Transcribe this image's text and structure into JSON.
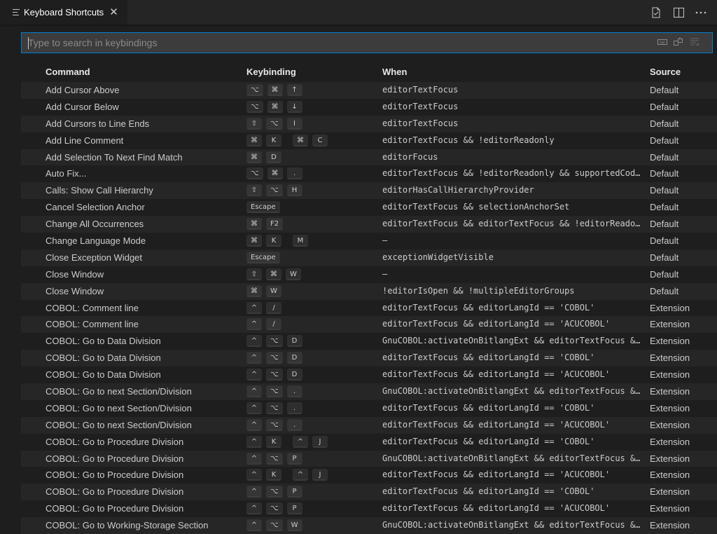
{
  "tab": {
    "title": "Keyboard Shortcuts",
    "close": "✕"
  },
  "actions": [
    "open-json-icon",
    "split-editor-icon",
    "more-actions-icon"
  ],
  "search": {
    "placeholder": "Type to search in keybindings",
    "value": ""
  },
  "columns": {
    "command": "Command",
    "keybinding": "Keybinding",
    "when": "When",
    "source": "Source"
  },
  "rows": [
    {
      "command": "Add Cursor Above",
      "keys": [
        [
          "⌥",
          "⌘",
          "↑"
        ]
      ],
      "when": "editorTextFocus",
      "source": "Default"
    },
    {
      "command": "Add Cursor Below",
      "keys": [
        [
          "⌥",
          "⌘",
          "↓"
        ]
      ],
      "when": "editorTextFocus",
      "source": "Default"
    },
    {
      "command": "Add Cursors to Line Ends",
      "keys": [
        [
          "⇧",
          "⌥",
          "I"
        ]
      ],
      "when": "editorTextFocus",
      "source": "Default"
    },
    {
      "command": "Add Line Comment",
      "keys": [
        [
          "⌘",
          "K"
        ],
        [
          "⌘",
          "C"
        ]
      ],
      "when": "editorTextFocus && !editorReadonly",
      "source": "Default"
    },
    {
      "command": "Add Selection To Next Find Match",
      "keys": [
        [
          "⌘",
          "D"
        ]
      ],
      "when": "editorFocus",
      "source": "Default"
    },
    {
      "command": "Auto Fix...",
      "keys": [
        [
          "⌥",
          "⌘",
          "."
        ]
      ],
      "when": "editorTextFocus && !editorReadonly && supportedCodeA…",
      "source": "Default"
    },
    {
      "command": "Calls: Show Call Hierarchy",
      "keys": [
        [
          "⇧",
          "⌥",
          "H"
        ]
      ],
      "when": "editorHasCallHierarchyProvider",
      "source": "Default"
    },
    {
      "command": "Cancel Selection Anchor",
      "keys": [
        [
          "Escape"
        ]
      ],
      "when": "editorTextFocus && selectionAnchorSet",
      "source": "Default"
    },
    {
      "command": "Change All Occurrences",
      "keys": [
        [
          "⌘",
          "F2"
        ]
      ],
      "when": "editorTextFocus && editorTextFocus && !editorReadonly",
      "source": "Default"
    },
    {
      "command": "Change Language Mode",
      "keys": [
        [
          "⌘",
          "K"
        ],
        [
          "M"
        ]
      ],
      "when": "—",
      "source": "Default"
    },
    {
      "command": "Close Exception Widget",
      "keys": [
        [
          "Escape"
        ]
      ],
      "when": "exceptionWidgetVisible",
      "source": "Default"
    },
    {
      "command": "Close Window",
      "keys": [
        [
          "⇧",
          "⌘",
          "W"
        ]
      ],
      "when": "—",
      "source": "Default"
    },
    {
      "command": "Close Window",
      "keys": [
        [
          "⌘",
          "W"
        ]
      ],
      "when": "!editorIsOpen && !multipleEditorGroups",
      "source": "Default"
    },
    {
      "command": "COBOL: Comment line",
      "keys": [
        [
          "^",
          "/"
        ]
      ],
      "when": "editorTextFocus && editorLangId == 'COBOL'",
      "source": "Extension"
    },
    {
      "command": "COBOL: Comment line",
      "keys": [
        [
          "^",
          "/"
        ]
      ],
      "when": "editorTextFocus && editorLangId == 'ACUCOBOL'",
      "source": "Extension"
    },
    {
      "command": "COBOL: Go to Data Division",
      "keys": [
        [
          "^",
          "⌥",
          "D"
        ]
      ],
      "when": "GnuCOBOL:activateOnBitlangExt && editorTextFocus && …",
      "source": "Extension"
    },
    {
      "command": "COBOL: Go to Data Division",
      "keys": [
        [
          "^",
          "⌥",
          "D"
        ]
      ],
      "when": "editorTextFocus && editorLangId == 'COBOL'",
      "source": "Extension"
    },
    {
      "command": "COBOL: Go to Data Division",
      "keys": [
        [
          "^",
          "⌥",
          "D"
        ]
      ],
      "when": "editorTextFocus && editorLangId == 'ACUCOBOL'",
      "source": "Extension"
    },
    {
      "command": "COBOL: Go to next Section/Division",
      "keys": [
        [
          "^",
          "⌥",
          "."
        ]
      ],
      "when": "GnuCOBOL:activateOnBitlangExt && editorTextFocus && …",
      "source": "Extension"
    },
    {
      "command": "COBOL: Go to next Section/Division",
      "keys": [
        [
          "^",
          "⌥",
          "."
        ]
      ],
      "when": "editorTextFocus && editorLangId == 'COBOL'",
      "source": "Extension"
    },
    {
      "command": "COBOL: Go to next Section/Division",
      "keys": [
        [
          "^",
          "⌥",
          "."
        ]
      ],
      "when": "editorTextFocus && editorLangId == 'ACUCOBOL'",
      "source": "Extension"
    },
    {
      "command": "COBOL: Go to Procedure Division",
      "keys": [
        [
          "^",
          "K"
        ],
        [
          "^",
          "J"
        ]
      ],
      "when": "editorTextFocus && editorLangId == 'COBOL'",
      "source": "Extension"
    },
    {
      "command": "COBOL: Go to Procedure Division",
      "keys": [
        [
          "^",
          "⌥",
          "P"
        ]
      ],
      "when": "GnuCOBOL:activateOnBitlangExt && editorTextFocus && …",
      "source": "Extension"
    },
    {
      "command": "COBOL: Go to Procedure Division",
      "keys": [
        [
          "^",
          "K"
        ],
        [
          "^",
          "J"
        ]
      ],
      "when": "editorTextFocus && editorLangId == 'ACUCOBOL'",
      "source": "Extension"
    },
    {
      "command": "COBOL: Go to Procedure Division",
      "keys": [
        [
          "^",
          "⌥",
          "P"
        ]
      ],
      "when": "editorTextFocus && editorLangId == 'COBOL'",
      "source": "Extension"
    },
    {
      "command": "COBOL: Go to Procedure Division",
      "keys": [
        [
          "^",
          "⌥",
          "P"
        ]
      ],
      "when": "editorTextFocus && editorLangId == 'ACUCOBOL'",
      "source": "Extension"
    },
    {
      "command": "COBOL: Go to Working-Storage Section",
      "keys": [
        [
          "^",
          "⌥",
          "W"
        ]
      ],
      "when": "GnuCOBOL:activateOnBitlangExt && editorTextFocus && …",
      "source": "Extension"
    }
  ]
}
